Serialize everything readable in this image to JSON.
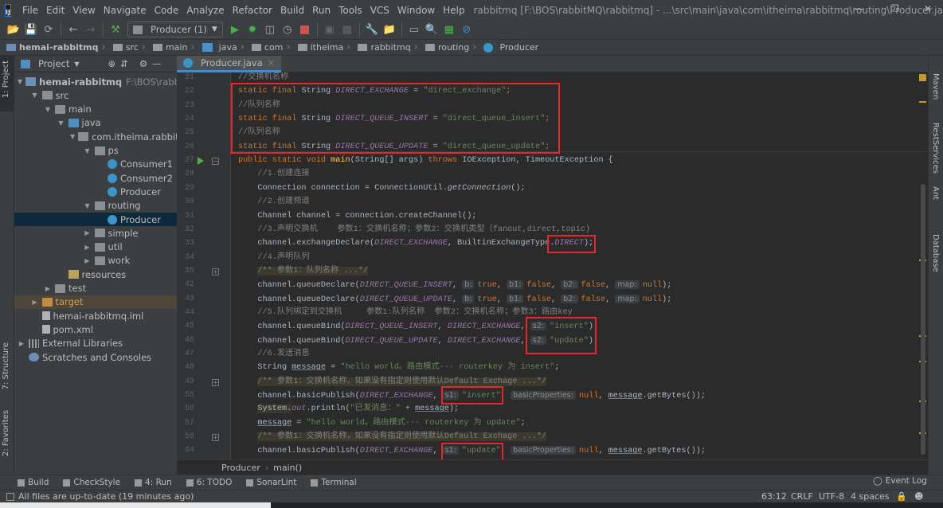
{
  "menubar": {
    "items": [
      "File",
      "Edit",
      "View",
      "Navigate",
      "Code",
      "Analyze",
      "Refactor",
      "Build",
      "Run",
      "Tools",
      "VCS",
      "Window",
      "Help"
    ],
    "title": "rabbitmq [F:\\BOS\\rabbitMQ\\rabbitmq] - ...\\src\\main\\java\\com\\itheima\\rabbitmq\\routing\\Producer.java"
  },
  "toolbar": {
    "run_config": "Producer (1)"
  },
  "breadcrumb": [
    "hemai-rabbitmq",
    "src",
    "main",
    "java",
    "com",
    "itheima",
    "rabbitmq",
    "routing",
    "Producer"
  ],
  "left_strip": {
    "project": "1: Project",
    "structure": "7: Structure",
    "favorites": "2: Favorites"
  },
  "right_strip": [
    "Maven",
    "RestServices",
    "Ant",
    "Database"
  ],
  "project_panel": {
    "title": "Project",
    "tree": [
      {
        "label": "hemai-rabbitmq",
        "extra": "F:\\BOS\\rabbitM",
        "level": 0,
        "arrow": "down",
        "icon": "module",
        "bold": true
      },
      {
        "label": "src",
        "level": 1,
        "arrow": "down",
        "icon": "folder"
      },
      {
        "label": "main",
        "level": 2,
        "arrow": "down",
        "icon": "folder"
      },
      {
        "label": "java",
        "level": 3,
        "arrow": "down",
        "icon": "src"
      },
      {
        "label": "com.itheima.rabbitmq",
        "level": 4,
        "arrow": "down",
        "icon": "pkg"
      },
      {
        "label": "ps",
        "level": 5,
        "arrow": "down",
        "icon": "pkg"
      },
      {
        "label": "Consumer1",
        "level": 6,
        "icon": "cls"
      },
      {
        "label": "Consumer2",
        "level": 6,
        "icon": "cls"
      },
      {
        "label": "Producer",
        "level": 6,
        "icon": "cls"
      },
      {
        "label": "routing",
        "level": 5,
        "arrow": "down",
        "icon": "pkg"
      },
      {
        "label": "Producer",
        "level": 6,
        "icon": "cls",
        "selected": true
      },
      {
        "label": "simple",
        "level": 5,
        "arrow": "right",
        "icon": "pkg"
      },
      {
        "label": "util",
        "level": 5,
        "arrow": "right",
        "icon": "pkg"
      },
      {
        "label": "work",
        "level": 5,
        "arrow": "right",
        "icon": "pkg"
      },
      {
        "label": "resources",
        "level": 3,
        "icon": "res"
      },
      {
        "label": "test",
        "level": 2,
        "arrow": "right",
        "icon": "folder"
      },
      {
        "label": "target",
        "level": 1,
        "arrow": "right",
        "icon": "target",
        "excluded": true
      },
      {
        "label": "hemai-rabbitmq.iml",
        "level": 1,
        "icon": "file"
      },
      {
        "label": "pom.xml",
        "level": 1,
        "icon": "file"
      },
      {
        "label": "External Libraries",
        "level": 0,
        "arrow": "right",
        "icon": "lib"
      },
      {
        "label": "Scratches and Consoles",
        "level": 0,
        "icon": "scr"
      }
    ]
  },
  "editor": {
    "tab": "Producer.java",
    "lines": [
      {
        "n": "21",
        "i": 1,
        "t": [
          [
            "cm",
            "//交换机名称"
          ]
        ]
      },
      {
        "n": "22",
        "i": 1,
        "t": [
          [
            "kw",
            "static final "
          ],
          [
            "",
            "String "
          ],
          [
            "c",
            "DIRECT_EXCHANGE"
          ],
          [
            "",
            " = "
          ],
          [
            "s",
            "\"direct_exchange\""
          ],
          [
            "kw",
            ";"
          ]
        ]
      },
      {
        "n": "23",
        "i": 1,
        "t": [
          [
            "cm",
            "//队列名称"
          ]
        ]
      },
      {
        "n": "24",
        "i": 1,
        "t": [
          [
            "kw",
            "static final "
          ],
          [
            "",
            "String "
          ],
          [
            "c",
            "DIRECT_QUEUE_INSERT"
          ],
          [
            "",
            " = "
          ],
          [
            "s",
            "\"direct_queue_insert\""
          ],
          [
            "kw",
            ";"
          ]
        ]
      },
      {
        "n": "25",
        "i": 1,
        "t": [
          [
            "cm",
            "//队列名称"
          ]
        ]
      },
      {
        "n": "26",
        "i": 1,
        "t": [
          [
            "kw",
            "static final "
          ],
          [
            "",
            "String "
          ],
          [
            "c",
            "DIRECT_QUEUE_UPDATE"
          ],
          [
            "",
            " = "
          ],
          [
            "s",
            "\"direct_queue_update\""
          ],
          [
            "kw",
            ";"
          ]
        ]
      },
      {
        "n": "27",
        "i": 1,
        "t": [
          [
            "kw",
            "public static void "
          ],
          [
            "fn",
            "main"
          ],
          [
            "",
            "(String[] args) "
          ],
          [
            "kw",
            "throws "
          ],
          [
            "",
            "IOException, TimeoutException {"
          ]
        ]
      },
      {
        "n": "28",
        "i": 2,
        "t": [
          [
            "cm",
            "//1.创建连接"
          ]
        ]
      },
      {
        "n": "29",
        "i": 2,
        "t": [
          [
            "",
            "Connection connection = ConnectionUtil."
          ],
          [
            "it",
            "getConnection"
          ],
          [
            "",
            "();"
          ]
        ]
      },
      {
        "n": "30",
        "i": 2,
        "t": [
          [
            "cm",
            "//2.创建频道"
          ]
        ]
      },
      {
        "n": "31",
        "i": 2,
        "t": [
          [
            "",
            "Channel channel = connection.createChannel();"
          ]
        ]
      },
      {
        "n": "32",
        "i": 2,
        "t": [
          [
            "cm",
            "//3.声明交换机    参数1：交换机名称；参数2：交换机类型（fanout,direct,topic)"
          ]
        ]
      },
      {
        "n": "33",
        "i": 2,
        "t": [
          [
            "",
            "channel.exchangeDeclare("
          ],
          [
            "c",
            "DIRECT_EXCHANGE"
          ],
          [
            "",
            ", BuiltinExchangeType."
          ],
          [
            "c",
            "DIRECT"
          ],
          [
            "",
            ");"
          ]
        ]
      },
      {
        "n": "34",
        "i": 2,
        "t": [
          [
            "cm",
            "//4.声明队列"
          ]
        ]
      },
      {
        "n": "35",
        "i": 2,
        "t": [
          [
            "doc",
            "/** 参数1：队列名称 ...*/"
          ]
        ]
      },
      {
        "n": "42",
        "i": 2,
        "t": [
          [
            "",
            "channel.queueDeclare("
          ],
          [
            "c",
            "DIRECT_QUEUE_INSERT"
          ],
          [
            "",
            ", "
          ],
          [
            "h",
            "b:"
          ],
          [
            "kw",
            "true"
          ],
          [
            "",
            ", "
          ],
          [
            "h",
            "b1:"
          ],
          [
            "kw",
            "false"
          ],
          [
            "",
            ", "
          ],
          [
            "h",
            "b2:"
          ],
          [
            "kw",
            "false"
          ],
          [
            "",
            ", "
          ],
          [
            "h",
            "map:"
          ],
          [
            "kw",
            "null"
          ],
          [
            "",
            ");"
          ]
        ]
      },
      {
        "n": "43",
        "i": 2,
        "t": [
          [
            "",
            "channel.queueDeclare("
          ],
          [
            "c",
            "DIRECT_QUEUE_UPDATE"
          ],
          [
            "",
            ", "
          ],
          [
            "h",
            "b:"
          ],
          [
            "kw",
            "true"
          ],
          [
            "",
            ", "
          ],
          [
            "h",
            "b1:"
          ],
          [
            "kw",
            "false"
          ],
          [
            "",
            ", "
          ],
          [
            "h",
            "b2:"
          ],
          [
            "kw",
            "false"
          ],
          [
            "",
            ", "
          ],
          [
            "h",
            "map:"
          ],
          [
            "kw",
            "null"
          ],
          [
            "",
            ");"
          ]
        ]
      },
      {
        "n": "44",
        "i": 2,
        "t": [
          [
            "cm",
            "//5.队列绑定到交换机     参数1:队列名称  参数2：交换机名称；参数3：路由key"
          ]
        ]
      },
      {
        "n": "45",
        "i": 2,
        "t": [
          [
            "",
            "channel.queueBind("
          ],
          [
            "c",
            "DIRECT_QUEUE_INSERT"
          ],
          [
            "",
            ", "
          ],
          [
            "c",
            "DIRECT_EXCHANGE"
          ],
          [
            "",
            ", "
          ],
          [
            "h",
            "s2:"
          ],
          [
            "s",
            "\"insert\""
          ],
          [
            "",
            ");"
          ]
        ]
      },
      {
        "n": "46",
        "i": 2,
        "t": [
          [
            "",
            "channel.queueBind("
          ],
          [
            "c",
            "DIRECT_QUEUE_UPDATE"
          ],
          [
            "",
            ", "
          ],
          [
            "c",
            "DIRECT_EXCHANGE"
          ],
          [
            "",
            ", "
          ],
          [
            "h",
            "s2:"
          ],
          [
            "s",
            "\"update\""
          ],
          [
            "",
            ");"
          ]
        ]
      },
      {
        "n": "47",
        "i": 2,
        "t": [
          [
            "cm",
            "//6.发送消息"
          ]
        ]
      },
      {
        "n": "48",
        "i": 2,
        "t": [
          [
            "",
            "String "
          ],
          [
            "u",
            "message"
          ],
          [
            "",
            " = "
          ],
          [
            "s",
            "\"hello world。路由模式--- routerkey 为 insert\""
          ],
          [
            "",
            ";"
          ]
        ]
      },
      {
        "n": "49",
        "i": 2,
        "t": [
          [
            "doc",
            "/** 参数1：交换机名称，如果没有指定则使用默认Default Exchage ...*/"
          ]
        ]
      },
      {
        "n": "55",
        "i": 2,
        "t": [
          [
            "",
            "channel.basicPublish("
          ],
          [
            "c",
            "DIRECT_EXCHANGE"
          ],
          [
            "",
            ", "
          ],
          [
            "h",
            "s1:"
          ],
          [
            "s",
            "\"insert\""
          ],
          [
            "",
            ", "
          ],
          [
            "h",
            "basicProperties:"
          ],
          [
            "kw",
            "null"
          ],
          [
            "",
            ", "
          ],
          [
            "u",
            "message"
          ],
          [
            "",
            ".getBytes());"
          ]
        ]
      },
      {
        "n": "56",
        "i": 2,
        "t": [
          [
            "sys",
            "System."
          ],
          [
            "c",
            "out"
          ],
          [
            "",
            ".println("
          ],
          [
            "s",
            "\"已发消息：\""
          ],
          [
            "",
            " + "
          ],
          [
            "u",
            "message"
          ],
          [
            "",
            ");"
          ]
        ]
      },
      {
        "n": "57",
        "i": 2,
        "t": [
          [
            "u",
            "message"
          ],
          [
            "",
            " = "
          ],
          [
            "s",
            "\"hello world。路由模式--- routerkey 为 update\""
          ],
          [
            "",
            ";"
          ]
        ]
      },
      {
        "n": "58",
        "i": 2,
        "t": [
          [
            "doc",
            "/** 参数1：交换机名称，如果没有指定则使用默认Default Exchage ...*/"
          ]
        ]
      },
      {
        "n": "64",
        "i": 2,
        "t": [
          [
            "",
            "channel.basicPublish("
          ],
          [
            "c",
            "DIRECT_EXCHANGE"
          ],
          [
            "",
            ", "
          ],
          [
            "h",
            "s1:"
          ],
          [
            "s",
            "\"update\""
          ],
          [
            "",
            ", "
          ],
          [
            "h",
            "basicProperties:"
          ],
          [
            "kw",
            "null"
          ],
          [
            "",
            ", "
          ],
          [
            "u",
            "message"
          ],
          [
            "",
            ".getBytes());"
          ]
        ]
      }
    ],
    "crumbs": [
      "Producer",
      "main()"
    ]
  },
  "bottom_tools": [
    "Build",
    "CheckStyle",
    "4: Run",
    "6: TODO",
    "SonarLint",
    "Terminal"
  ],
  "event_log": "Event Log",
  "status": {
    "message": "All files are up-to-date (19 minutes ago)",
    "position": "63:12",
    "line_sep": "CRLF",
    "encoding": "UTF-8",
    "indent": "4 spaces"
  },
  "colors": {
    "highlight_box": "#e8262c",
    "keyword": "#cc7832",
    "constant": "#9876aa",
    "string": "#6a8759",
    "comment": "#808080"
  }
}
